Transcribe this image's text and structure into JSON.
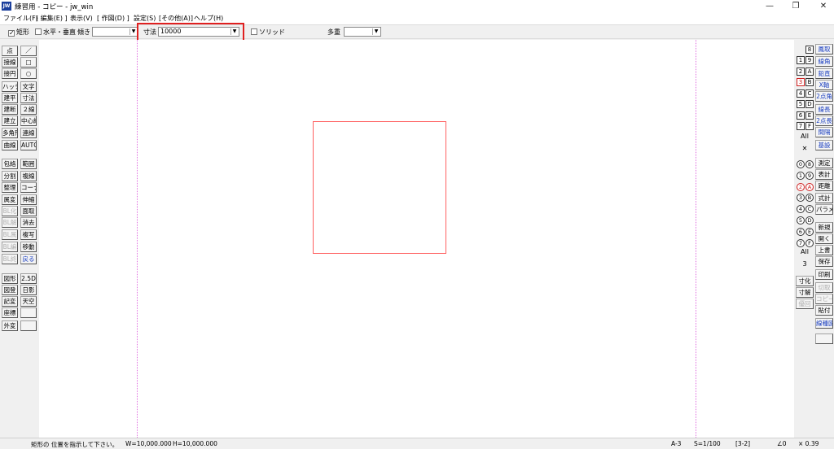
{
  "title_bar": {
    "app_icon_text": "JW",
    "title": "練習用 - コピー - jw_win",
    "minimize": "—",
    "maximize": "❐",
    "close": "✕"
  },
  "menu": [
    "ファイル(F)",
    "[ 編集(E) ]",
    "表示(V)",
    "[ 作図(D) ]",
    "設定(S)",
    "[その他(A)]",
    "ヘルプ(H)"
  ],
  "toolbar": {
    "rect_label": "矩形",
    "rect_checked": "✓",
    "hv_label": "水平・垂直",
    "tilt_label": "傾き",
    "tilt_value": "",
    "dim_label": "寸法",
    "dim_value": "10000",
    "solid_label": "ソリッド",
    "multi_label": "多重",
    "multi_value": "",
    "dropdown_arrow": "▼"
  },
  "left_tools": [
    [
      "点",
      "／"
    ],
    [
      "接線",
      "□"
    ],
    [
      "接円",
      "○"
    ],
    [
      "ハッチ",
      "文字"
    ],
    [
      "建平",
      "寸法"
    ],
    [
      "建断",
      "２線"
    ],
    [
      "建立",
      "中心線"
    ],
    [
      "多角形",
      "連線"
    ],
    [
      "曲線",
      "AUTO"
    ],
    [
      "包絡",
      "範囲"
    ],
    [
      "分割",
      "複線"
    ],
    [
      "整理",
      "コーナー"
    ],
    [
      "属変",
      "伸縮"
    ],
    [
      "BL化",
      "面取"
    ],
    [
      "BL解",
      "消去"
    ],
    [
      "BL属",
      "複写"
    ],
    [
      "BL編",
      "移動"
    ],
    [
      "BL終",
      "戻る"
    ],
    [
      "図形",
      "2.5D"
    ],
    [
      "図登",
      "日影"
    ],
    [
      "記変",
      "天空"
    ],
    [
      "座標",
      ""
    ],
    [
      "外変",
      ""
    ]
  ],
  "right_layers": {
    "top_label": "8",
    "layers": [
      [
        "1",
        "9"
      ],
      [
        "2",
        "A"
      ],
      [
        "3",
        "B"
      ],
      [
        "4",
        "C"
      ],
      [
        "5",
        "D"
      ],
      [
        "6",
        "E"
      ],
      [
        "7",
        "F"
      ]
    ],
    "all": "All",
    "cross": "✕",
    "groups": [
      [
        "0",
        "8"
      ],
      [
        "1",
        "9"
      ],
      [
        "2",
        "A"
      ],
      [
        "3",
        "B"
      ],
      [
        "4",
        "C"
      ],
      [
        "5",
        "D"
      ],
      [
        "6",
        "E"
      ],
      [
        "7",
        "F"
      ]
    ],
    "groups_all": "All",
    "groups_num": "3",
    "dim_labels": [
      "寸化",
      "寸解",
      "優回"
    ]
  },
  "right_tools": [
    "鳳取",
    "線角",
    "鉛直",
    "X軸",
    "2点角",
    "線長",
    "2点長",
    "間隔",
    "基設",
    "測定",
    "表計",
    "距離",
    "式計",
    "パラメ",
    "新規",
    "開く",
    "上書",
    "保存",
    "印刷",
    "切取",
    "コピー",
    "貼付",
    "線種図"
  ],
  "canvas": {
    "frame_color": "#e070e0",
    "rect_color": "#ff6060"
  },
  "status": {
    "message": "矩形の 位置を指示して下さい。",
    "width": "W=10,000.000",
    "height": "H=10,000.000",
    "paper": "A-3",
    "scale": "S=1/100",
    "layer": "[3-2]",
    "angle": "∠0",
    "zoom": "× 0.39"
  }
}
